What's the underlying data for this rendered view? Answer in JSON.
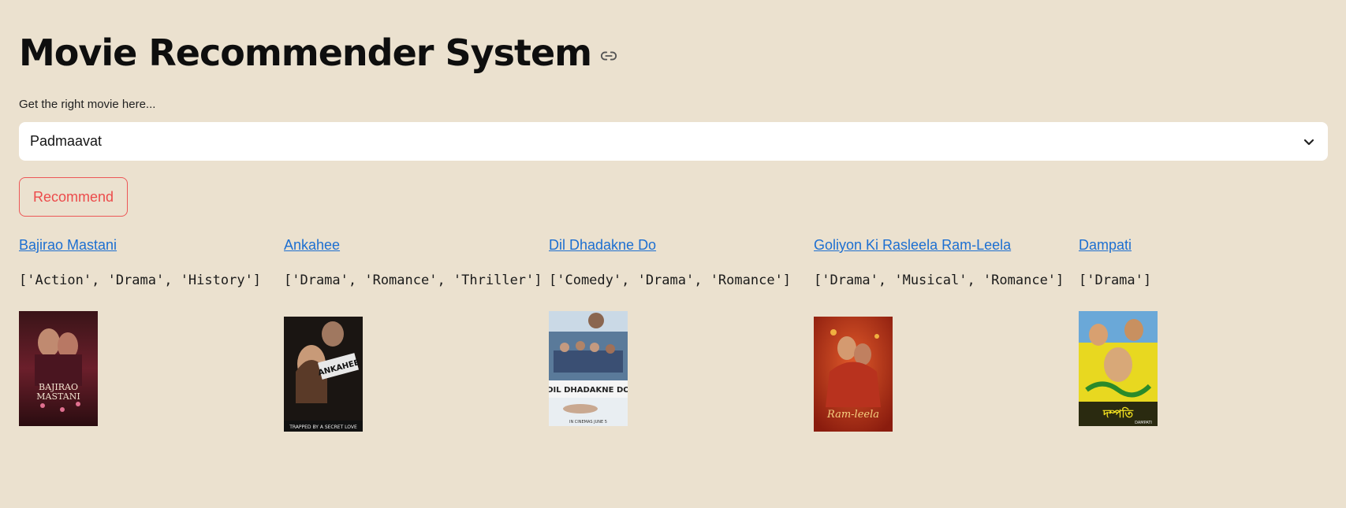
{
  "header": {
    "title": "Movie Recommender System",
    "anchor_icon": "link-icon"
  },
  "selector": {
    "label": "Get the right movie here...",
    "selected_value": "Padmaavat",
    "dropdown_icon": "chevron-down-icon"
  },
  "actions": {
    "recommend_label": "Recommend"
  },
  "recommendations": [
    {
      "title": "Bajirao Mastani",
      "genres": "['Action', 'Drama', 'History']",
      "poster_text": "BAJIRAO MASTANI"
    },
    {
      "title": "Ankahee",
      "genres": "['Drama', 'Romance', 'Thriller']",
      "poster_text": "ANKAHEE",
      "poster_tagline": "TRAPPED BY A SECRET LOVE"
    },
    {
      "title": "Dil Dhadakne Do",
      "genres": "['Comedy', 'Drama', 'Romance']",
      "poster_text": "DIL DHADAKNE DO",
      "poster_tagline": "IN CINEMAS JUNE 5"
    },
    {
      "title": "Goliyon Ki Rasleela Ram-Leela",
      "genres": "['Drama', 'Musical', 'Romance']",
      "poster_text": "Ram-leela"
    },
    {
      "title": "Dampati",
      "genres": "['Drama']",
      "poster_text": "দম্পতি",
      "poster_tagline": "DAMPATI"
    }
  ],
  "colors": {
    "background": "#ebe1cf",
    "link": "#1d6fd1",
    "accent": "#ec4b4b"
  }
}
